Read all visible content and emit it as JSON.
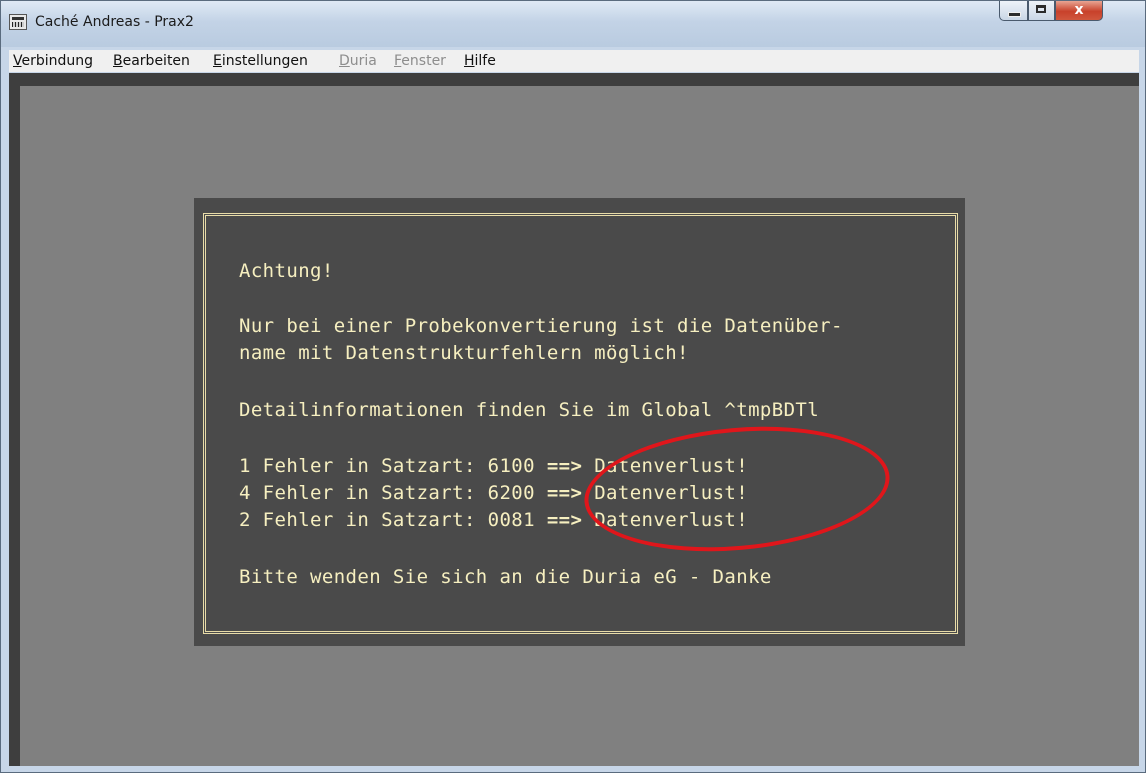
{
  "window": {
    "title": "Caché Andreas - Prax2",
    "close_glyph": "x"
  },
  "menubar": {
    "items": [
      {
        "label": "Verbindung",
        "mnemonic": "V",
        "rest": "erbindung",
        "enabled": true
      },
      {
        "label": "Bearbeiten",
        "mnemonic": "B",
        "rest": "earbeiten",
        "enabled": true
      },
      {
        "label": "Einstellungen",
        "mnemonic": "E",
        "rest": "instellungen",
        "enabled": true
      },
      {
        "label": "Duria",
        "mnemonic": "D",
        "rest": "uria",
        "enabled": false
      },
      {
        "label": "Fenster",
        "mnemonic": "F",
        "rest": "enster",
        "enabled": false
      },
      {
        "label": "Hilfe",
        "mnemonic": "H",
        "rest": "ilfe",
        "enabled": true
      }
    ]
  },
  "terminal": {
    "heading": "Achtung!",
    "message_line1": "Nur bei einer Probekonvertierung ist die Datenüber-",
    "message_line2": "name mit Datenstrukturfehlern möglich!",
    "detail_info": "Detailinformationen finden Sie im Global ^tmpBDTl",
    "errors": [
      {
        "prefix": "1 Fehler in Satzart: 6100 ",
        "arrow": "==>",
        "suffix": " Datenverlust!"
      },
      {
        "prefix": "4 Fehler in Satzart: 6200 ",
        "arrow": "==>",
        "suffix": " Datenverlust!"
      },
      {
        "prefix": "2 Fehler in Satzart: 0081 ",
        "arrow": "==>",
        "suffix": " Datenverlust!"
      }
    ],
    "footer": "Bitte wenden Sie sich an die Duria eG - Danke"
  },
  "colors": {
    "terminal_text": "#f6efc0",
    "dialog_background": "#4a4a4a",
    "terminal_background": "#808080",
    "frame_border": "#e8dca8",
    "annotation_circle": "#e0161b"
  }
}
